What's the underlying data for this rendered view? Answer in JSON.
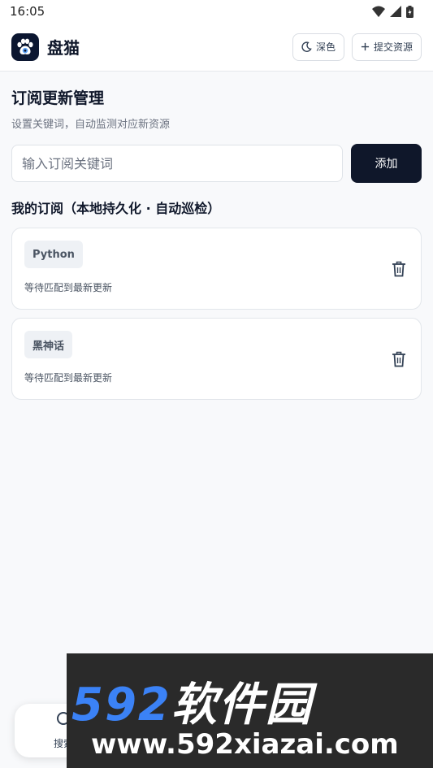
{
  "status_bar": {
    "time": "16:05"
  },
  "header": {
    "app_title": "盘猫",
    "dark_label": "深色",
    "submit_label": "提交资源"
  },
  "page": {
    "title": "订阅更新管理",
    "subtitle": "设置关键词，自动监测对应新资源"
  },
  "form": {
    "placeholder": "输入订阅关键词",
    "value": "",
    "add_label": "添加"
  },
  "subscriptions": {
    "title": "我的订阅（本地持久化 · 自动巡检）",
    "items": [
      {
        "keyword": "Python",
        "status": "等待匹配到最新更新"
      },
      {
        "keyword": "黑神话",
        "status": "等待匹配到最新更新"
      }
    ]
  },
  "bottom_nav": {
    "search_label": "搜索"
  },
  "watermark": {
    "brand_num": "592",
    "brand_cn": "软件园",
    "url": "www.592xiazai.com"
  },
  "colors": {
    "primary": "#0f172a",
    "accent": "#3b82f6",
    "background": "#f8f9fb"
  },
  "icons": {
    "logo": "paw-icon",
    "dark_mode": "moon-icon",
    "submit": "plus-icon",
    "delete": "trash-icon",
    "search": "search-icon"
  }
}
